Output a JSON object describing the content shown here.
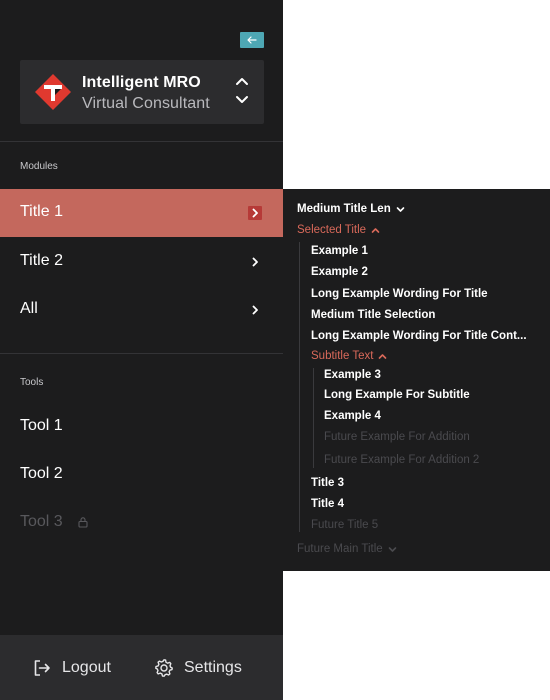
{
  "brand": {
    "title": "Intelligent MRO",
    "subtitle": "Virtual Consultant",
    "colors": {
      "logo_red": "#e0392f",
      "accent": "#4ea7b4"
    }
  },
  "sidebar": {
    "modules_label": "Modules",
    "modules": [
      {
        "label": "Title 1",
        "active": true
      },
      {
        "label": "Title 2",
        "active": false
      },
      {
        "label": "All",
        "active": false
      }
    ],
    "tools_label": "Tools",
    "tools": [
      {
        "label": "Tool 1",
        "locked": false
      },
      {
        "label": "Tool 2",
        "locked": false
      },
      {
        "label": "Tool 3",
        "locked": true
      }
    ],
    "footer": {
      "logout_label": "Logout",
      "settings_label": "Settings"
    }
  },
  "panel": {
    "header": "Medium Title Len",
    "selected_title": "Selected Title",
    "examples": [
      "Example 1",
      "Example 2",
      "Long Example Wording For Title",
      "Medium Title Selection",
      "Long Example Wording For Title Cont..."
    ],
    "subtitle": "Subtitle Text",
    "sub_examples": [
      "Example 3",
      "Long Example For Subtitle",
      "Example 4"
    ],
    "future_sub": [
      "Future Example For Addition",
      "Future Example For Addition 2"
    ],
    "titles": [
      "Title 3",
      "Title 4"
    ],
    "future_title": "Future Title 5",
    "future_main": "Future Main Title",
    "colors": {
      "accent": "#d9695a",
      "active_bg": "#c4685d"
    }
  }
}
